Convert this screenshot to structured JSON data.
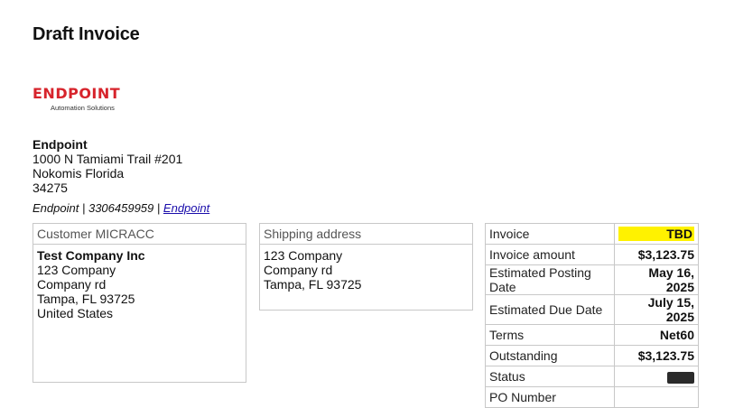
{
  "page": {
    "title": "Draft Invoice"
  },
  "logo": {
    "name": "ENDPOINT",
    "tagline": "Automation Solutions",
    "brand_color": "#d7242c"
  },
  "company": {
    "name": "Endpoint",
    "address_line1": "1000 N Tamiami Trail #201",
    "address_line2": "Nokomis Florida",
    "postal_code": "34275",
    "contact_name": "Endpoint",
    "separator": "|",
    "phone": "3306459959",
    "link_text": "Endpoint"
  },
  "customer": {
    "header": "Customer MICRACC",
    "name": "Test Company Inc",
    "line1": "123 Company",
    "line2": "Company rd",
    "line3": "Tampa, FL 93725",
    "line4": "United States"
  },
  "shipping": {
    "header": "Shipping address",
    "line1": "123 Company",
    "line2": "Company rd",
    "line3": "Tampa, FL 93725"
  },
  "invoice": {
    "rows": [
      {
        "label": "Invoice",
        "value": "TBD"
      },
      {
        "label": "Invoice amount",
        "value": "$3,123.75"
      },
      {
        "label": "Estimated Posting Date",
        "value": "May 16, 2025"
      },
      {
        "label": "Estimated Due Date",
        "value": "July 15, 2025"
      },
      {
        "label": "Terms",
        "value": "Net60"
      },
      {
        "label": "Outstanding",
        "value": "$3,123.75"
      },
      {
        "label": "Status",
        "value": ""
      },
      {
        "label": "PO Number",
        "value": ""
      }
    ],
    "highlight_color": "#fff200"
  }
}
